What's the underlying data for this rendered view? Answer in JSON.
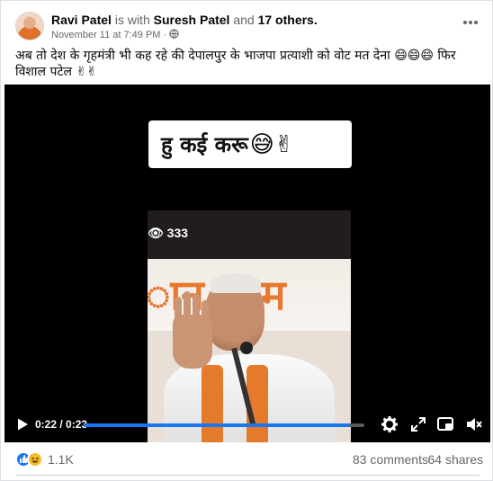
{
  "post": {
    "author": "Ravi Patel",
    "with_text": "is with",
    "tagged": "Suresh Patel",
    "and_text": "and",
    "others": "17 others.",
    "timestamp": "November 11 at 7:49 PM",
    "separator": "·",
    "more_icon": "more-horizontal-icon",
    "caption": "अब तो देश के गृहमंत्री भी कह रहे की  देपालपुर के भाजपा प्रत्याशी को वोट मत देना 😄😄😄  फिर विशाल पटेल ✌✌"
  },
  "video": {
    "banner_text": "हु कई करू",
    "banner_emoji": "😅✌",
    "views": "👁 333",
    "wall_text": "ान ल म",
    "current_time": "0:22",
    "duration": "0:23",
    "time_display": "0:22 / 0:23",
    "progress": 0.95,
    "icons": [
      "play-icon",
      "settings-icon",
      "fullscreen-icon",
      "picture-in-picture-icon",
      "volume-muted-icon"
    ]
  },
  "stats": {
    "reaction_count": "1.1K",
    "comments": "83 comments",
    "shares": "64 shares"
  },
  "colors": {
    "accent": "#1877f2",
    "text_secondary": "#65676b"
  }
}
